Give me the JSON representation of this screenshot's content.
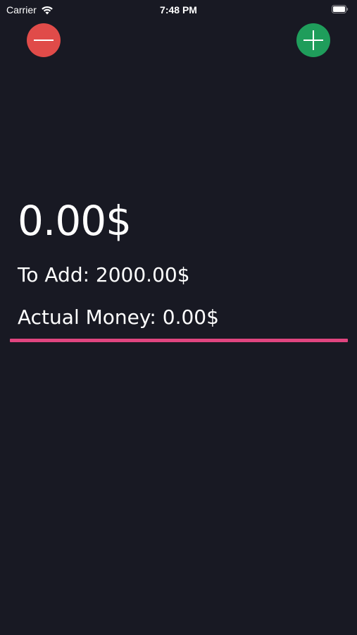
{
  "status_bar": {
    "carrier": "Carrier",
    "time": "7:48 PM",
    "icons": [
      "wifi-icon",
      "battery-icon"
    ]
  },
  "actions": {
    "remove_icon": "minus-icon",
    "add_icon": "plus-icon",
    "remove_color": "#e04b49",
    "add_color": "#1f9d5b"
  },
  "money": {
    "balance": "0.00$",
    "to_add": "To Add: 2000.00$",
    "actual_money": "Actual Money: 0.00$"
  },
  "colors": {
    "background": "#181923",
    "accent_line": "#e0457f"
  }
}
